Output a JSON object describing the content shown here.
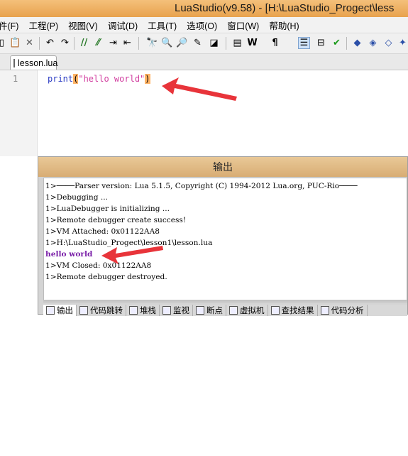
{
  "window": {
    "title": "LuaStudio(v9.58) - [H:\\LuaStudio_Progect\\less"
  },
  "menu": [
    "件(F)",
    "工程(P)",
    "视图(V)",
    "调试(D)",
    "工具(T)",
    "选项(O)",
    "窗口(W)",
    "帮助(H)"
  ],
  "toolbar_icons": [
    "copy-icon",
    "paste-icon",
    "delete-icon",
    "undo-icon",
    "redo-icon",
    "comment-icon",
    "uncomment-icon",
    "indent-icon",
    "outdent-icon",
    "find-icon",
    "find-next-icon",
    "find-prev-icon",
    "replace-icon",
    "highlight-icon",
    "word-wrap-icon",
    "pilcrow-icon",
    "line-numbers-icon",
    "fold-icon",
    "check-icon",
    "bookmark-icon",
    "bookmark-next-icon",
    "bookmark-prev-icon",
    "bookmark-clear-icon"
  ],
  "tab": {
    "label": "lesson.lua"
  },
  "editor": {
    "line_number": "1",
    "code": {
      "keyword": "print",
      "open": "(",
      "string": "\"hello world\"",
      "close": ")"
    }
  },
  "output": {
    "title": "输出",
    "lines": [
      "1>────Parser version: Lua 5.1.5, Copyright (C) 1994-2012 Lua.org, PUC-Rio────",
      "1>Debugging ...",
      "1>LuaDebugger is initializing ...",
      "1>Remote debugger create success!",
      "1>VM Attached: 0x01122AA8",
      "1>H:\\LuaStudio_Progect\\lesson1\\lesson.lua",
      "hello world",
      "1>VM Closed: 0x01122AA8",
      "1>Remote debugger destroyed."
    ]
  },
  "bottom_tabs": [
    "输出",
    "代码跳转",
    "堆栈",
    "监视",
    "断点",
    "虚拟机",
    "查找结果",
    "代码分析"
  ],
  "colors": {
    "accent_arrow": "#e8343a",
    "keyword": "#2b3cc4",
    "string": "#d23fa0",
    "output_highlight": "#7a1fa8"
  }
}
